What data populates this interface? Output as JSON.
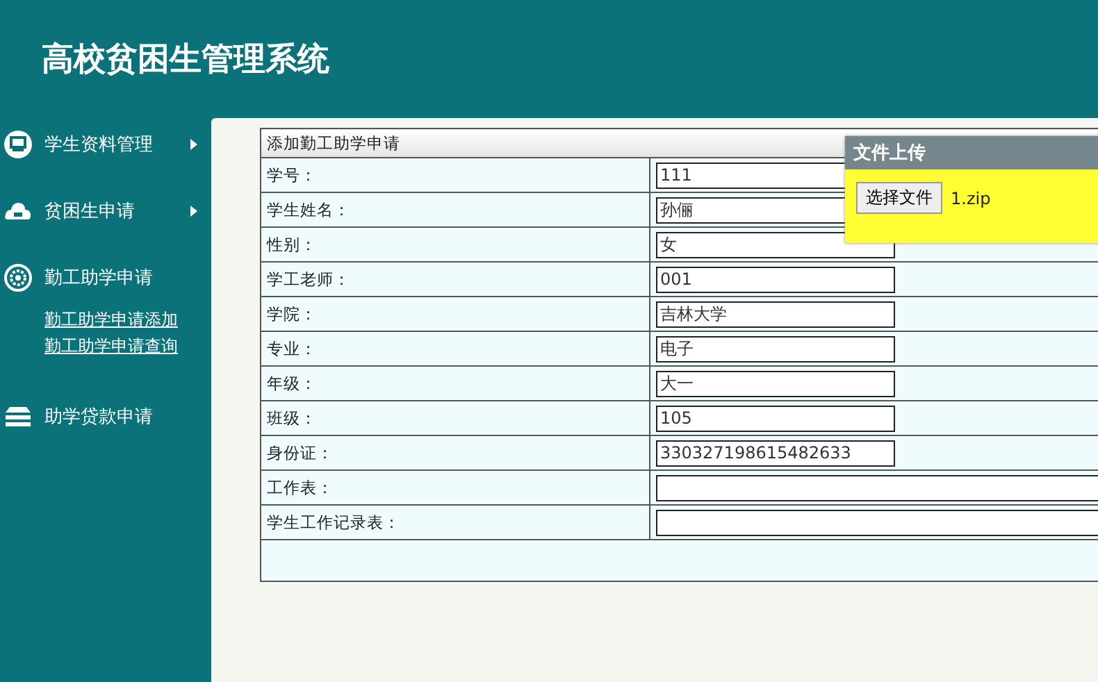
{
  "header": {
    "title": "高校贫困生管理系统"
  },
  "sidebar": {
    "items": [
      {
        "label": "学生资料管理",
        "kind": "monitor",
        "arrow": true
      },
      {
        "label": "贫困生申请",
        "kind": "cloud",
        "arrow": true
      },
      {
        "label": "勤工助学申请",
        "kind": "gear",
        "arrow": false,
        "children": [
          {
            "label": "勤工助学申请添加"
          },
          {
            "label": "勤工助学申请查询"
          }
        ]
      },
      {
        "label": "助学贷款申请",
        "kind": "stack",
        "arrow": false
      }
    ]
  },
  "form": {
    "title": "添加勤工助学申请",
    "rows": [
      {
        "label": "学号：",
        "kind": "text",
        "value": "111"
      },
      {
        "label": "学生姓名：",
        "kind": "text",
        "value": "孙俪"
      },
      {
        "label": "性别：",
        "kind": "text",
        "value": "女"
      },
      {
        "label": "学工老师：",
        "kind": "text",
        "value": "001"
      },
      {
        "label": "学院：",
        "kind": "text",
        "value": "吉林大学"
      },
      {
        "label": "专业：",
        "kind": "text",
        "value": "电子"
      },
      {
        "label": "年级：",
        "kind": "text",
        "value": "大一"
      },
      {
        "label": "班级：",
        "kind": "text",
        "value": "105"
      },
      {
        "label": "身份证：",
        "kind": "text",
        "value": "330327198615482633"
      },
      {
        "label": "工作表：",
        "kind": "file"
      },
      {
        "label": "学生工作记录表：",
        "kind": "file"
      }
    ]
  },
  "upload_dialog": {
    "title": "文件上传",
    "button": "选择文件",
    "file_name": "1.zip"
  }
}
